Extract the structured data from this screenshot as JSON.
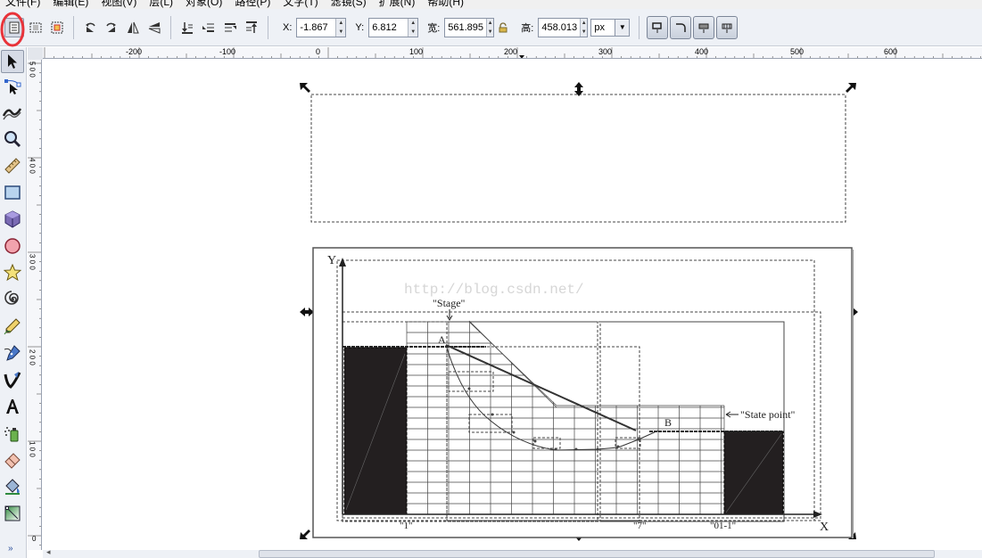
{
  "menu": [
    "文件(F)",
    "编辑(E)",
    "视图(V)",
    "层(L)",
    "对象(O)",
    "路径(P)",
    "文字(T)",
    "滤镜(S)",
    "扩展(N)",
    "帮助(H)"
  ],
  "coords": {
    "x_label": "X:",
    "x_value": "-1.867",
    "y_label": "Y:",
    "y_value": "6.812",
    "w_label": "宽:",
    "w_value": "561.895",
    "h_label": "高:",
    "h_value": "458.013",
    "unit": "px"
  },
  "hruler_labels": [
    "-200",
    "-100",
    "0",
    "100",
    "200",
    "300",
    "400",
    "500",
    "600"
  ],
  "vruler_labels": [
    "5 0 0",
    "4 0 0",
    "3 0 0",
    "2 0 0",
    "1 0 0",
    "0"
  ],
  "drawing": {
    "watermark": "http://blog.csdn.net/",
    "axis_y": "Y",
    "axis_x": "X",
    "label_stage": "\"Stage\"",
    "label_state_point": "\"State point\"",
    "point_a": "A",
    "point_b": "B",
    "tick_1": "\"1\"",
    "tick_7": "\"7\"",
    "tick_01": "\"01-1\""
  },
  "colors": {
    "accent": "#e8333a",
    "toolbar_bg": "#eef1f6",
    "fill_dark": "#231f20"
  }
}
